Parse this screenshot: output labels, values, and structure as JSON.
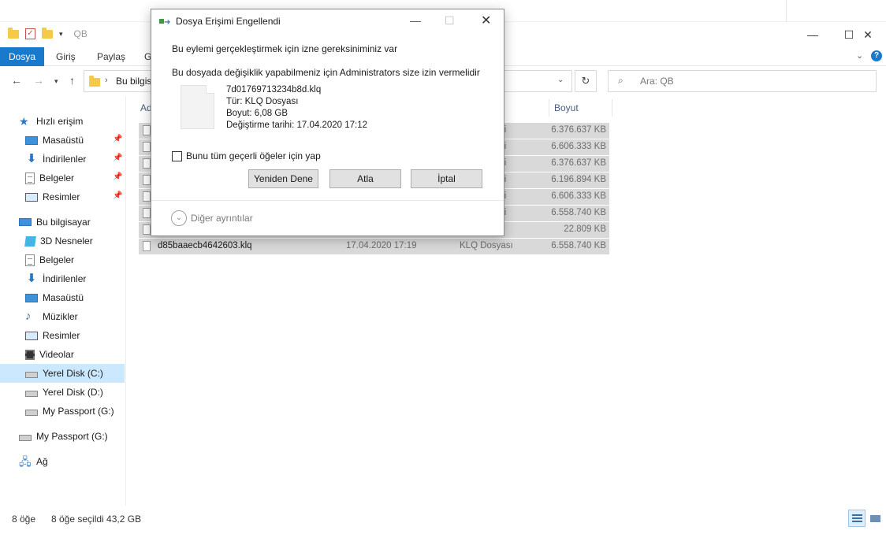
{
  "window": {
    "quick_access_title": "QB",
    "minimize_icon": "minimize-icon",
    "maximize_icon": "maximize-icon",
    "close_icon": "close-icon"
  },
  "ribbon": {
    "tabs": [
      "Dosya",
      "Giriş",
      "Paylaş",
      "G"
    ],
    "accent_color": "#1979ca",
    "help_label": "?"
  },
  "nav": {
    "address_path": "Bu bilgis",
    "search_placeholder": "Ara: QB",
    "refresh_label": "↻"
  },
  "sidebar": {
    "quick_access": {
      "label": "Hızlı erişim",
      "items": [
        "Masaüstü",
        "İndirilenler",
        "Belgeler",
        "Resimler"
      ]
    },
    "this_pc": {
      "label": "Bu bilgisayar",
      "items": [
        "3D Nesneler",
        "Belgeler",
        "İndirilenler",
        "Masaüstü",
        "Müzikler",
        "Resimler",
        "Videolar",
        "Yerel Disk (C:)",
        "Yerel Disk (D:)",
        "My Passport (G:)"
      ]
    },
    "my_passport": "My Passport (G:)",
    "network": "Ağ",
    "selected_item": "Yerel Disk (C:)"
  },
  "list": {
    "columns": [
      "Ad",
      "Boyut"
    ],
    "rows": [
      {
        "name": "",
        "date": "",
        "type": "si",
        "size": "6.376.637 KB"
      },
      {
        "name": "",
        "date": "",
        "type": "si",
        "size": "6.606.333 KB"
      },
      {
        "name": "",
        "date": "",
        "type": "si",
        "size": "6.376.637 KB"
      },
      {
        "name": "",
        "date": "",
        "type": "si",
        "size": "6.196.894 KB"
      },
      {
        "name": "",
        "date": "",
        "type": "si",
        "size": "6.606.333 KB"
      },
      {
        "name": "",
        "date": "",
        "type": "si",
        "size": "6.558.740 KB"
      },
      {
        "name": "",
        "date": "",
        "type": "",
        "size": "22.809 KB"
      },
      {
        "name": "d85baaecb4642603.klq",
        "date": "17.04.2020 17:19",
        "type": "KLQ Dosyası",
        "size": "6.558.740 KB"
      }
    ]
  },
  "status": {
    "item_count": "8 öğe",
    "selected": "8 öğe seçildi  43,2 GB"
  },
  "dialog": {
    "title": "Dosya Erişimi Engellendi",
    "heading": "Bu eylemi gerçekleştirmek için izne gereksiniminiz var",
    "message": "Bu dosyada değişiklik yapabilmeniz için Administrators size izin vermelidir",
    "file_name": "7d01769713234b8d.klq",
    "file_type": "Tür: KLQ Dosyası",
    "file_size": "Boyut: 6,08 GB",
    "file_modified": "Değiştirme tarihi: 17.04.2020 17:12",
    "checkbox_label": "Bunu tüm geçerli öğeler için yap",
    "buttons": {
      "retry": "Yeniden Dene",
      "skip": "Atla",
      "cancel": "İptal"
    },
    "more_details": "Diğer ayrıntılar"
  }
}
